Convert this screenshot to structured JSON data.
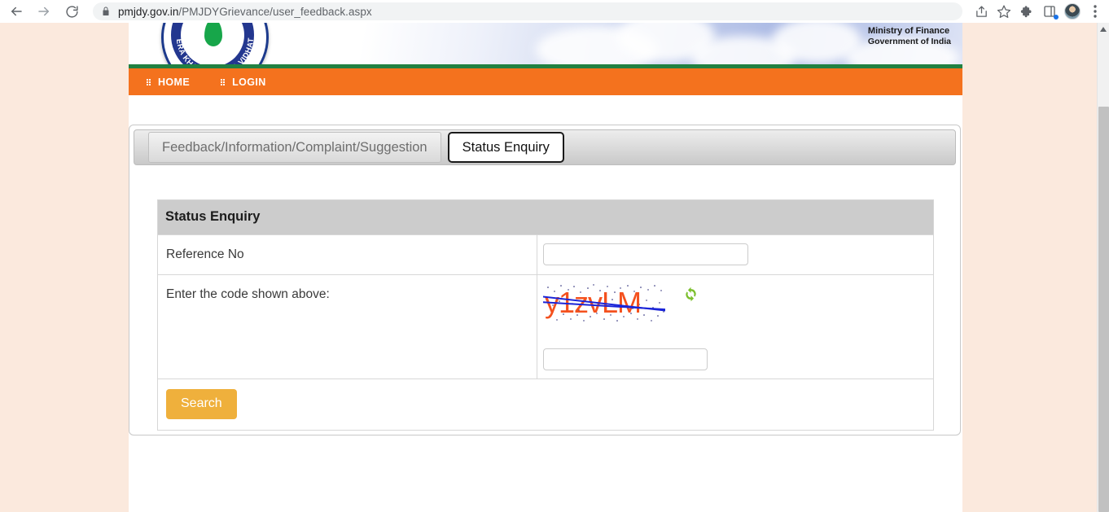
{
  "browser": {
    "url_domain": "pmjdy.gov.in",
    "url_path": "/PMJDYGrievance/user_feedback.aspx",
    "back_icon": "back-arrow-icon",
    "forward_icon": "forward-arrow-icon",
    "reload_icon": "reload-icon",
    "lock_icon": "lock-icon",
    "share_icon": "share-icon",
    "bookmark_icon": "star-icon",
    "extensions_icon": "puzzle-piece-icon",
    "sidepanel_icon": "side-panel-icon",
    "profile_icon": "avatar-icon",
    "menu_icon": "three-dot-menu-icon"
  },
  "site": {
    "logo_motto": "MERA KHATA BHAGYA VIDHATA",
    "ministry_line1": "Ministry of Finance",
    "ministry_line2": "Government of India",
    "nav": [
      {
        "label": "HOME"
      },
      {
        "label": "LOGIN"
      }
    ]
  },
  "tabs": [
    {
      "label": "Feedback/Information/Complaint/Suggestion",
      "active": false
    },
    {
      "label": "Status Enquiry",
      "active": true
    }
  ],
  "panel": {
    "title": "Status Enquiry",
    "rows": [
      {
        "label": "Reference No",
        "input_value": "",
        "input_placeholder": ""
      },
      {
        "label": "Enter the code shown above:",
        "captcha_text": "y1zvLM",
        "refresh_icon": "refresh-icon",
        "input_value": "",
        "input_placeholder": ""
      }
    ],
    "search_label": "Search"
  },
  "colors": {
    "nav_orange": "#f4721e",
    "green_stripe": "#218142",
    "search_button": "#efb03c",
    "panel_header": "#cccccc",
    "captcha_text": "#f4511e",
    "captcha_line": "#1a24d8",
    "page_background": "#fbe9dd"
  }
}
